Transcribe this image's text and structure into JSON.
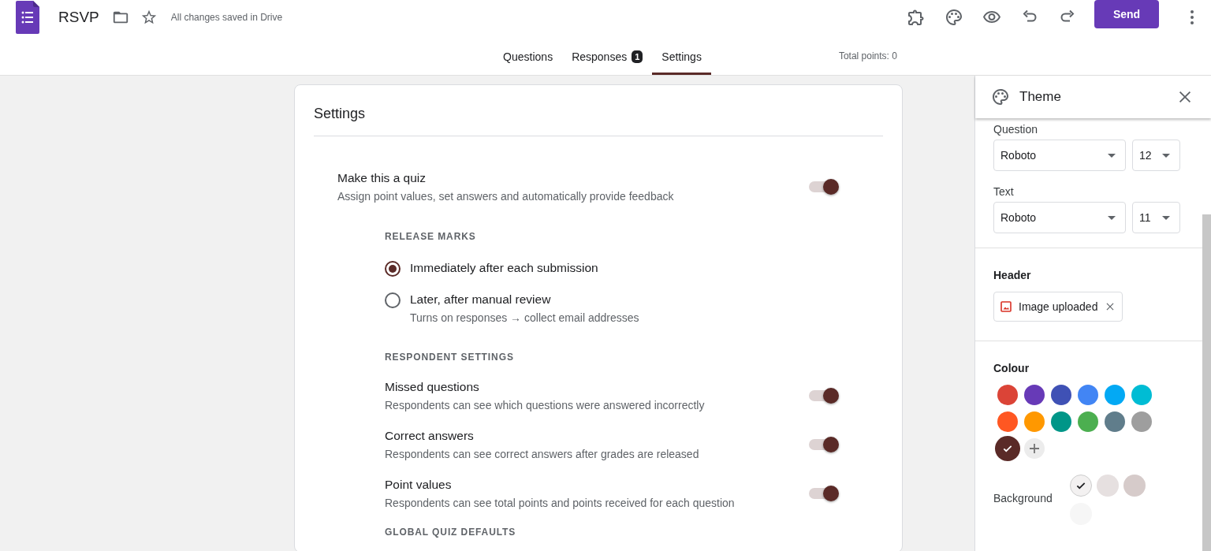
{
  "app": {
    "title": "RSVP",
    "save_status": "All changes saved in Drive",
    "send_button": "Send"
  },
  "tabs": [
    {
      "label": "Questions",
      "selected": false
    },
    {
      "label": "Responses",
      "selected": false,
      "badge": "1"
    },
    {
      "label": "Settings",
      "selected": true
    }
  ],
  "total_points": "Total points: 0",
  "settings": {
    "title": "Settings",
    "quiz": {
      "label": "Make this a quiz",
      "description": "Assign point values, set answers and automatically provide feedback",
      "on": true
    },
    "sections": [
      {
        "heading": "RELEASE MARKS",
        "items": [
          {
            "kind": "radio",
            "label": "Immediately after each submission",
            "selected": true
          },
          {
            "kind": "radio",
            "label": "Later, after manual review",
            "description": "Turns on responses → collect email addresses",
            "selected": false
          }
        ]
      },
      {
        "heading": "RESPONDENT SETTINGS",
        "items": [
          {
            "kind": "toggle",
            "label": "Missed questions",
            "description": "Respondents can see which questions were answered incorrectly",
            "on": true
          },
          {
            "kind": "toggle",
            "label": "Correct answers",
            "description": "Respondents can see correct answers after grades are released",
            "on": true
          },
          {
            "kind": "toggle",
            "label": "Point values",
            "description": "Respondents can see total points and points received for each question",
            "on": true
          }
        ]
      },
      {
        "heading": "GLOBAL QUIZ DEFAULTS"
      }
    ]
  },
  "theme": {
    "title": "Theme",
    "fonts": [
      {
        "label": "Question",
        "font": "Roboto",
        "size": "12"
      },
      {
        "label": "Text",
        "font": "Roboto",
        "size": "11"
      }
    ],
    "header": {
      "label": "Header",
      "image_chip": "Image uploaded"
    },
    "colour": {
      "label": "Colour",
      "swatches": [
        {
          "color": "#db4437",
          "selected": false
        },
        {
          "color": "#673ab7",
          "selected": false
        },
        {
          "color": "#3f51b5",
          "selected": false
        },
        {
          "color": "#4285f4",
          "selected": false
        },
        {
          "color": "#03a9f4",
          "selected": false
        },
        {
          "color": "#00bcd4",
          "selected": false
        },
        {
          "color": "#ff5722",
          "selected": false
        },
        {
          "color": "#ff9800",
          "selected": false
        },
        {
          "color": "#009688",
          "selected": false
        },
        {
          "color": "#4caf50",
          "selected": false
        },
        {
          "color": "#607d8b",
          "selected": false
        },
        {
          "color": "#9e9e9e",
          "selected": false
        },
        {
          "color": "#5a2a27",
          "selected": true
        }
      ]
    },
    "background": {
      "label": "Background",
      "swatches": [
        {
          "color": "#f3f1f1",
          "selected": true
        },
        {
          "color": "#e6e0e0",
          "selected": false
        },
        {
          "color": "#d6cbca",
          "selected": false
        },
        {
          "color": "#f6f6f6",
          "selected": false
        }
      ]
    }
  }
}
